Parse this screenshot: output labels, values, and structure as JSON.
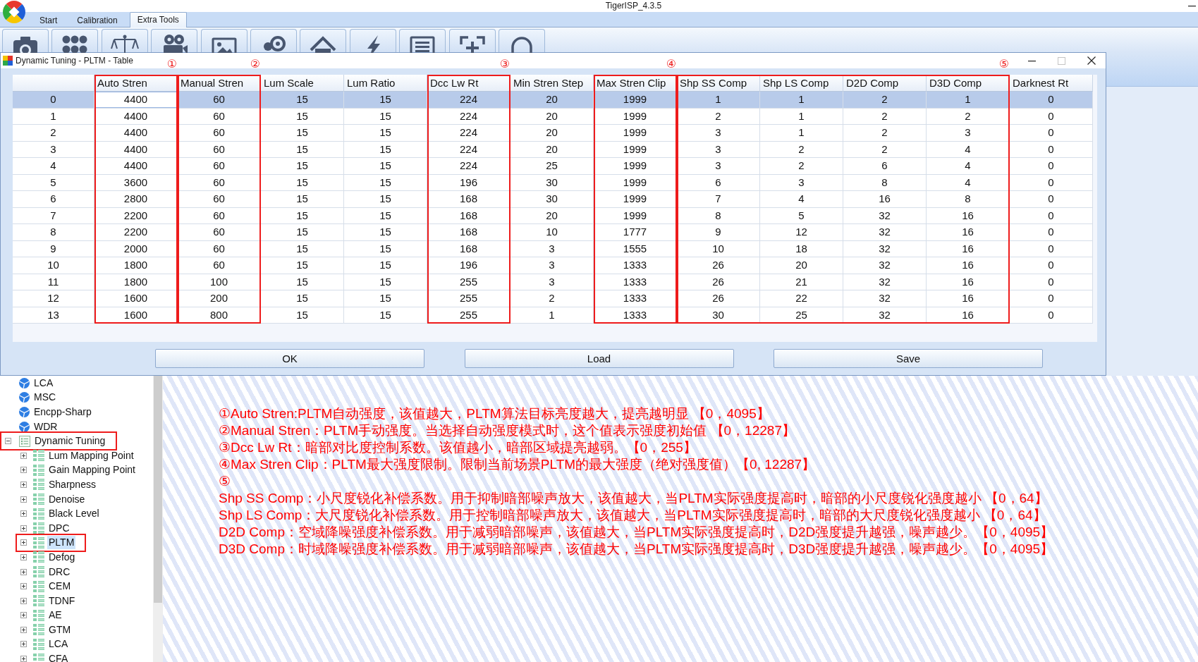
{
  "app": {
    "title": "TigerISP_4.3.5"
  },
  "tabs": [
    {
      "label": "Start",
      "selected": false
    },
    {
      "label": "Calibration",
      "selected": false
    },
    {
      "label": "Extra Tools",
      "selected": true
    }
  ],
  "dialog": {
    "title": "Dynamic Tuning - PLTM - Table",
    "maximize_disabled": true,
    "table": {
      "column_groups": [
        {
          "callout": "①",
          "columns": [
            "Auto Stren"
          ]
        },
        {
          "callout": "②",
          "columns": [
            "Manual Stren"
          ]
        },
        {
          "columns": [
            "Lum Scale",
            "Lum Ratio"
          ]
        },
        {
          "callout": "③",
          "columns": [
            "Dcc Lw Rt"
          ]
        },
        {
          "columns": [
            "Min Stren Step"
          ]
        },
        {
          "callout": "④",
          "columns": [
            "Max Stren Clip"
          ]
        },
        {
          "callout": "⑤",
          "columns": [
            "Shp SS Comp",
            "Shp LS Comp",
            "D2D Comp",
            "D3D Comp"
          ]
        },
        {
          "columns": [
            "Darknest Rt"
          ]
        }
      ],
      "rows": [
        {
          "label": "0",
          "selected": true,
          "cells": [
            {
              "value": "4400",
              "focused": true
            },
            {
              "value": "60",
              "focused": false
            },
            {
              "value": "15",
              "focused": false
            },
            {
              "value": "15",
              "focused": false
            },
            {
              "value": "224",
              "focused": false
            },
            {
              "value": "20",
              "focused": false
            },
            {
              "value": "1999",
              "focused": false
            },
            {
              "value": "1",
              "focused": false
            },
            {
              "value": "1",
              "focused": false
            },
            {
              "value": "2",
              "focused": false
            },
            {
              "value": "1",
              "focused": false
            },
            {
              "value": "0",
              "focused": false
            }
          ]
        },
        {
          "label": "1",
          "selected": false,
          "cells": [
            {
              "value": "4400",
              "focused": false
            },
            {
              "value": "60",
              "focused": false
            },
            {
              "value": "15",
              "focused": false
            },
            {
              "value": "15",
              "focused": false
            },
            {
              "value": "224",
              "focused": false
            },
            {
              "value": "20",
              "focused": false
            },
            {
              "value": "1999",
              "focused": false
            },
            {
              "value": "2",
              "focused": false
            },
            {
              "value": "1",
              "focused": false
            },
            {
              "value": "2",
              "focused": false
            },
            {
              "value": "2",
              "focused": false
            },
            {
              "value": "0",
              "focused": false
            }
          ]
        },
        {
          "label": "2",
          "selected": false,
          "cells": [
            {
              "value": "4400",
              "focused": false
            },
            {
              "value": "60",
              "focused": false
            },
            {
              "value": "15",
              "focused": false
            },
            {
              "value": "15",
              "focused": false
            },
            {
              "value": "224",
              "focused": false
            },
            {
              "value": "20",
              "focused": false
            },
            {
              "value": "1999",
              "focused": false
            },
            {
              "value": "3",
              "focused": false
            },
            {
              "value": "1",
              "focused": false
            },
            {
              "value": "2",
              "focused": false
            },
            {
              "value": "3",
              "focused": false
            },
            {
              "value": "0",
              "focused": false
            }
          ]
        },
        {
          "label": "3",
          "selected": false,
          "cells": [
            {
              "value": "4400",
              "focused": false
            },
            {
              "value": "60",
              "focused": false
            },
            {
              "value": "15",
              "focused": false
            },
            {
              "value": "15",
              "focused": false
            },
            {
              "value": "224",
              "focused": false
            },
            {
              "value": "20",
              "focused": false
            },
            {
              "value": "1999",
              "focused": false
            },
            {
              "value": "3",
              "focused": false
            },
            {
              "value": "2",
              "focused": false
            },
            {
              "value": "2",
              "focused": false
            },
            {
              "value": "4",
              "focused": false
            },
            {
              "value": "0",
              "focused": false
            }
          ]
        },
        {
          "label": "4",
          "selected": false,
          "cells": [
            {
              "value": "4400",
              "focused": false
            },
            {
              "value": "60",
              "focused": false
            },
            {
              "value": "15",
              "focused": false
            },
            {
              "value": "15",
              "focused": false
            },
            {
              "value": "224",
              "focused": false
            },
            {
              "value": "25",
              "focused": false
            },
            {
              "value": "1999",
              "focused": false
            },
            {
              "value": "3",
              "focused": false
            },
            {
              "value": "2",
              "focused": false
            },
            {
              "value": "6",
              "focused": false
            },
            {
              "value": "4",
              "focused": false
            },
            {
              "value": "0",
              "focused": false
            }
          ]
        },
        {
          "label": "5",
          "selected": false,
          "cells": [
            {
              "value": "3600",
              "focused": false
            },
            {
              "value": "60",
              "focused": false
            },
            {
              "value": "15",
              "focused": false
            },
            {
              "value": "15",
              "focused": false
            },
            {
              "value": "196",
              "focused": false
            },
            {
              "value": "30",
              "focused": false
            },
            {
              "value": "1999",
              "focused": false
            },
            {
              "value": "6",
              "focused": false
            },
            {
              "value": "3",
              "focused": false
            },
            {
              "value": "8",
              "focused": false
            },
            {
              "value": "4",
              "focused": false
            },
            {
              "value": "0",
              "focused": false
            }
          ]
        },
        {
          "label": "6",
          "selected": false,
          "cells": [
            {
              "value": "2800",
              "focused": false
            },
            {
              "value": "60",
              "focused": false
            },
            {
              "value": "15",
              "focused": false
            },
            {
              "value": "15",
              "focused": false
            },
            {
              "value": "168",
              "focused": false
            },
            {
              "value": "30",
              "focused": false
            },
            {
              "value": "1999",
              "focused": false
            },
            {
              "value": "7",
              "focused": false
            },
            {
              "value": "4",
              "focused": false
            },
            {
              "value": "16",
              "focused": false
            },
            {
              "value": "8",
              "focused": false
            },
            {
              "value": "0",
              "focused": false
            }
          ]
        },
        {
          "label": "7",
          "selected": false,
          "cells": [
            {
              "value": "2200",
              "focused": false
            },
            {
              "value": "60",
              "focused": false
            },
            {
              "value": "15",
              "focused": false
            },
            {
              "value": "15",
              "focused": false
            },
            {
              "value": "168",
              "focused": false
            },
            {
              "value": "20",
              "focused": false
            },
            {
              "value": "1999",
              "focused": false
            },
            {
              "value": "8",
              "focused": false
            },
            {
              "value": "5",
              "focused": false
            },
            {
              "value": "32",
              "focused": false
            },
            {
              "value": "16",
              "focused": false
            },
            {
              "value": "0",
              "focused": false
            }
          ]
        },
        {
          "label": "8",
          "selected": false,
          "cells": [
            {
              "value": "2200",
              "focused": false
            },
            {
              "value": "60",
              "focused": false
            },
            {
              "value": "15",
              "focused": false
            },
            {
              "value": "15",
              "focused": false
            },
            {
              "value": "168",
              "focused": false
            },
            {
              "value": "10",
              "focused": false
            },
            {
              "value": "1777",
              "focused": false
            },
            {
              "value": "9",
              "focused": false
            },
            {
              "value": "12",
              "focused": false
            },
            {
              "value": "32",
              "focused": false
            },
            {
              "value": "16",
              "focused": false
            },
            {
              "value": "0",
              "focused": false
            }
          ]
        },
        {
          "label": "9",
          "selected": false,
          "cells": [
            {
              "value": "2000",
              "focused": false
            },
            {
              "value": "60",
              "focused": false
            },
            {
              "value": "15",
              "focused": false
            },
            {
              "value": "15",
              "focused": false
            },
            {
              "value": "168",
              "focused": false
            },
            {
              "value": "3",
              "focused": false
            },
            {
              "value": "1555",
              "focused": false
            },
            {
              "value": "10",
              "focused": false
            },
            {
              "value": "18",
              "focused": false
            },
            {
              "value": "32",
              "focused": false
            },
            {
              "value": "16",
              "focused": false
            },
            {
              "value": "0",
              "focused": false
            }
          ]
        },
        {
          "label": "10",
          "selected": false,
          "cells": [
            {
              "value": "1800",
              "focused": false
            },
            {
              "value": "60",
              "focused": false
            },
            {
              "value": "15",
              "focused": false
            },
            {
              "value": "15",
              "focused": false
            },
            {
              "value": "196",
              "focused": false
            },
            {
              "value": "3",
              "focused": false
            },
            {
              "value": "1333",
              "focused": false
            },
            {
              "value": "26",
              "focused": false
            },
            {
              "value": "20",
              "focused": false
            },
            {
              "value": "32",
              "focused": false
            },
            {
              "value": "16",
              "focused": false
            },
            {
              "value": "0",
              "focused": false
            }
          ]
        },
        {
          "label": "11",
          "selected": false,
          "cells": [
            {
              "value": "1800",
              "focused": false
            },
            {
              "value": "100",
              "focused": false
            },
            {
              "value": "15",
              "focused": false
            },
            {
              "value": "15",
              "focused": false
            },
            {
              "value": "255",
              "focused": false
            },
            {
              "value": "3",
              "focused": false
            },
            {
              "value": "1333",
              "focused": false
            },
            {
              "value": "26",
              "focused": false
            },
            {
              "value": "21",
              "focused": false
            },
            {
              "value": "32",
              "focused": false
            },
            {
              "value": "16",
              "focused": false
            },
            {
              "value": "0",
              "focused": false
            }
          ]
        },
        {
          "label": "12",
          "selected": false,
          "cells": [
            {
              "value": "1600",
              "focused": false
            },
            {
              "value": "200",
              "focused": false
            },
            {
              "value": "15",
              "focused": false
            },
            {
              "value": "15",
              "focused": false
            },
            {
              "value": "255",
              "focused": false
            },
            {
              "value": "2",
              "focused": false
            },
            {
              "value": "1333",
              "focused": false
            },
            {
              "value": "26",
              "focused": false
            },
            {
              "value": "22",
              "focused": false
            },
            {
              "value": "32",
              "focused": false
            },
            {
              "value": "16",
              "focused": false
            },
            {
              "value": "0",
              "focused": false
            }
          ]
        },
        {
          "label": "13",
          "selected": false,
          "cells": [
            {
              "value": "1600",
              "focused": false
            },
            {
              "value": "800",
              "focused": false
            },
            {
              "value": "15",
              "focused": false
            },
            {
              "value": "15",
              "focused": false
            },
            {
              "value": "255",
              "focused": false
            },
            {
              "value": "1",
              "focused": false
            },
            {
              "value": "1333",
              "focused": false
            },
            {
              "value": "30",
              "focused": false
            },
            {
              "value": "25",
              "focused": false
            },
            {
              "value": "32",
              "focused": false
            },
            {
              "value": "16",
              "focused": false
            },
            {
              "value": "0",
              "focused": false
            }
          ]
        }
      ]
    },
    "buttons": [
      "OK",
      "Load",
      "Save"
    ]
  },
  "tree": [
    {
      "label": "LCA",
      "kind": "module",
      "selected": false,
      "framed": false
    },
    {
      "label": "MSC",
      "kind": "module",
      "selected": false,
      "framed": false
    },
    {
      "label": "Encpp-Sharp",
      "kind": "module",
      "selected": false,
      "framed": false
    },
    {
      "label": "WDR",
      "kind": "module",
      "selected": false,
      "framed": false
    },
    {
      "label": "Dynamic Tuning",
      "kind": "folder",
      "expanded": true,
      "selected": false,
      "framed": true,
      "children": [
        {
          "label": "Lum Mapping Point",
          "kind": "table",
          "expanded": false,
          "selected": false,
          "framed": false
        },
        {
          "label": "Gain Mapping Point",
          "kind": "table",
          "expanded": false,
          "selected": false,
          "framed": false
        },
        {
          "label": "Sharpness",
          "kind": "table",
          "expanded": false,
          "selected": false,
          "framed": false
        },
        {
          "label": "Denoise",
          "kind": "table",
          "expanded": false,
          "selected": false,
          "framed": false
        },
        {
          "label": "Black Level",
          "kind": "table",
          "expanded": false,
          "selected": false,
          "framed": false
        },
        {
          "label": "DPC",
          "kind": "table",
          "expanded": false,
          "selected": false,
          "framed": false
        },
        {
          "label": "PLTM",
          "kind": "table",
          "expanded": false,
          "selected": true,
          "framed": true
        },
        {
          "label": "Defog",
          "kind": "table",
          "expanded": false,
          "selected": false,
          "framed": false
        },
        {
          "label": "DRC",
          "kind": "table",
          "expanded": false,
          "selected": false,
          "framed": false
        },
        {
          "label": "CEM",
          "kind": "table",
          "expanded": false,
          "selected": false,
          "framed": false
        },
        {
          "label": "TDNF",
          "kind": "table",
          "expanded": false,
          "selected": false,
          "framed": false
        },
        {
          "label": "AE",
          "kind": "table",
          "expanded": false,
          "selected": false,
          "framed": false
        },
        {
          "label": "GTM",
          "kind": "table",
          "expanded": false,
          "selected": false,
          "framed": false
        },
        {
          "label": "LCA",
          "kind": "table",
          "expanded": false,
          "selected": false,
          "framed": false
        },
        {
          "label": "CFA",
          "kind": "table",
          "expanded": false,
          "selected": false,
          "framed": false
        }
      ]
    }
  ],
  "notes": [
    "①Auto Stren:PLTM自动强度，该值越大，PLTM算法目标亮度越大，提亮越明显 【0，4095】",
    "②Manual Stren：PLTM手动强度。当选择自动强度模式时，这个值表示强度初始值 【0，12287】",
    "③Dcc Lw Rt：暗部对比度控制系数。该值越小，暗部区域提亮越弱。【0，255】",
    "④Max Stren Clip：PLTM最大强度限制。限制当前场景PLTM的最大强度（绝对强度值）【0, 12287】",
    "⑤",
    "Shp SS Comp：小尺度锐化补偿系数。用于抑制暗部噪声放大，该值越大，当PLTM实际强度提高时，暗部的小尺度锐化强度越小 【0，64】",
    "Shp LS Comp：大尺度锐化补偿系数。用于控制暗部噪声放大，该值越大，当PLTM实际强度提高时，暗部的大尺度锐化强度越小 【0，64】",
    "D2D Comp：空域降噪强度补偿系数。用于减弱暗部噪声，该值越大，当PLTM实际强度提高时，D2D强度提升越强，噪声越少。【0，4095】",
    "D3D Comp：时域降噪强度补偿系数。用于减弱暗部噪声，该值越大，当PLTM实际强度提高时，D3D强度提升越强，噪声越少。【0，4095】"
  ]
}
